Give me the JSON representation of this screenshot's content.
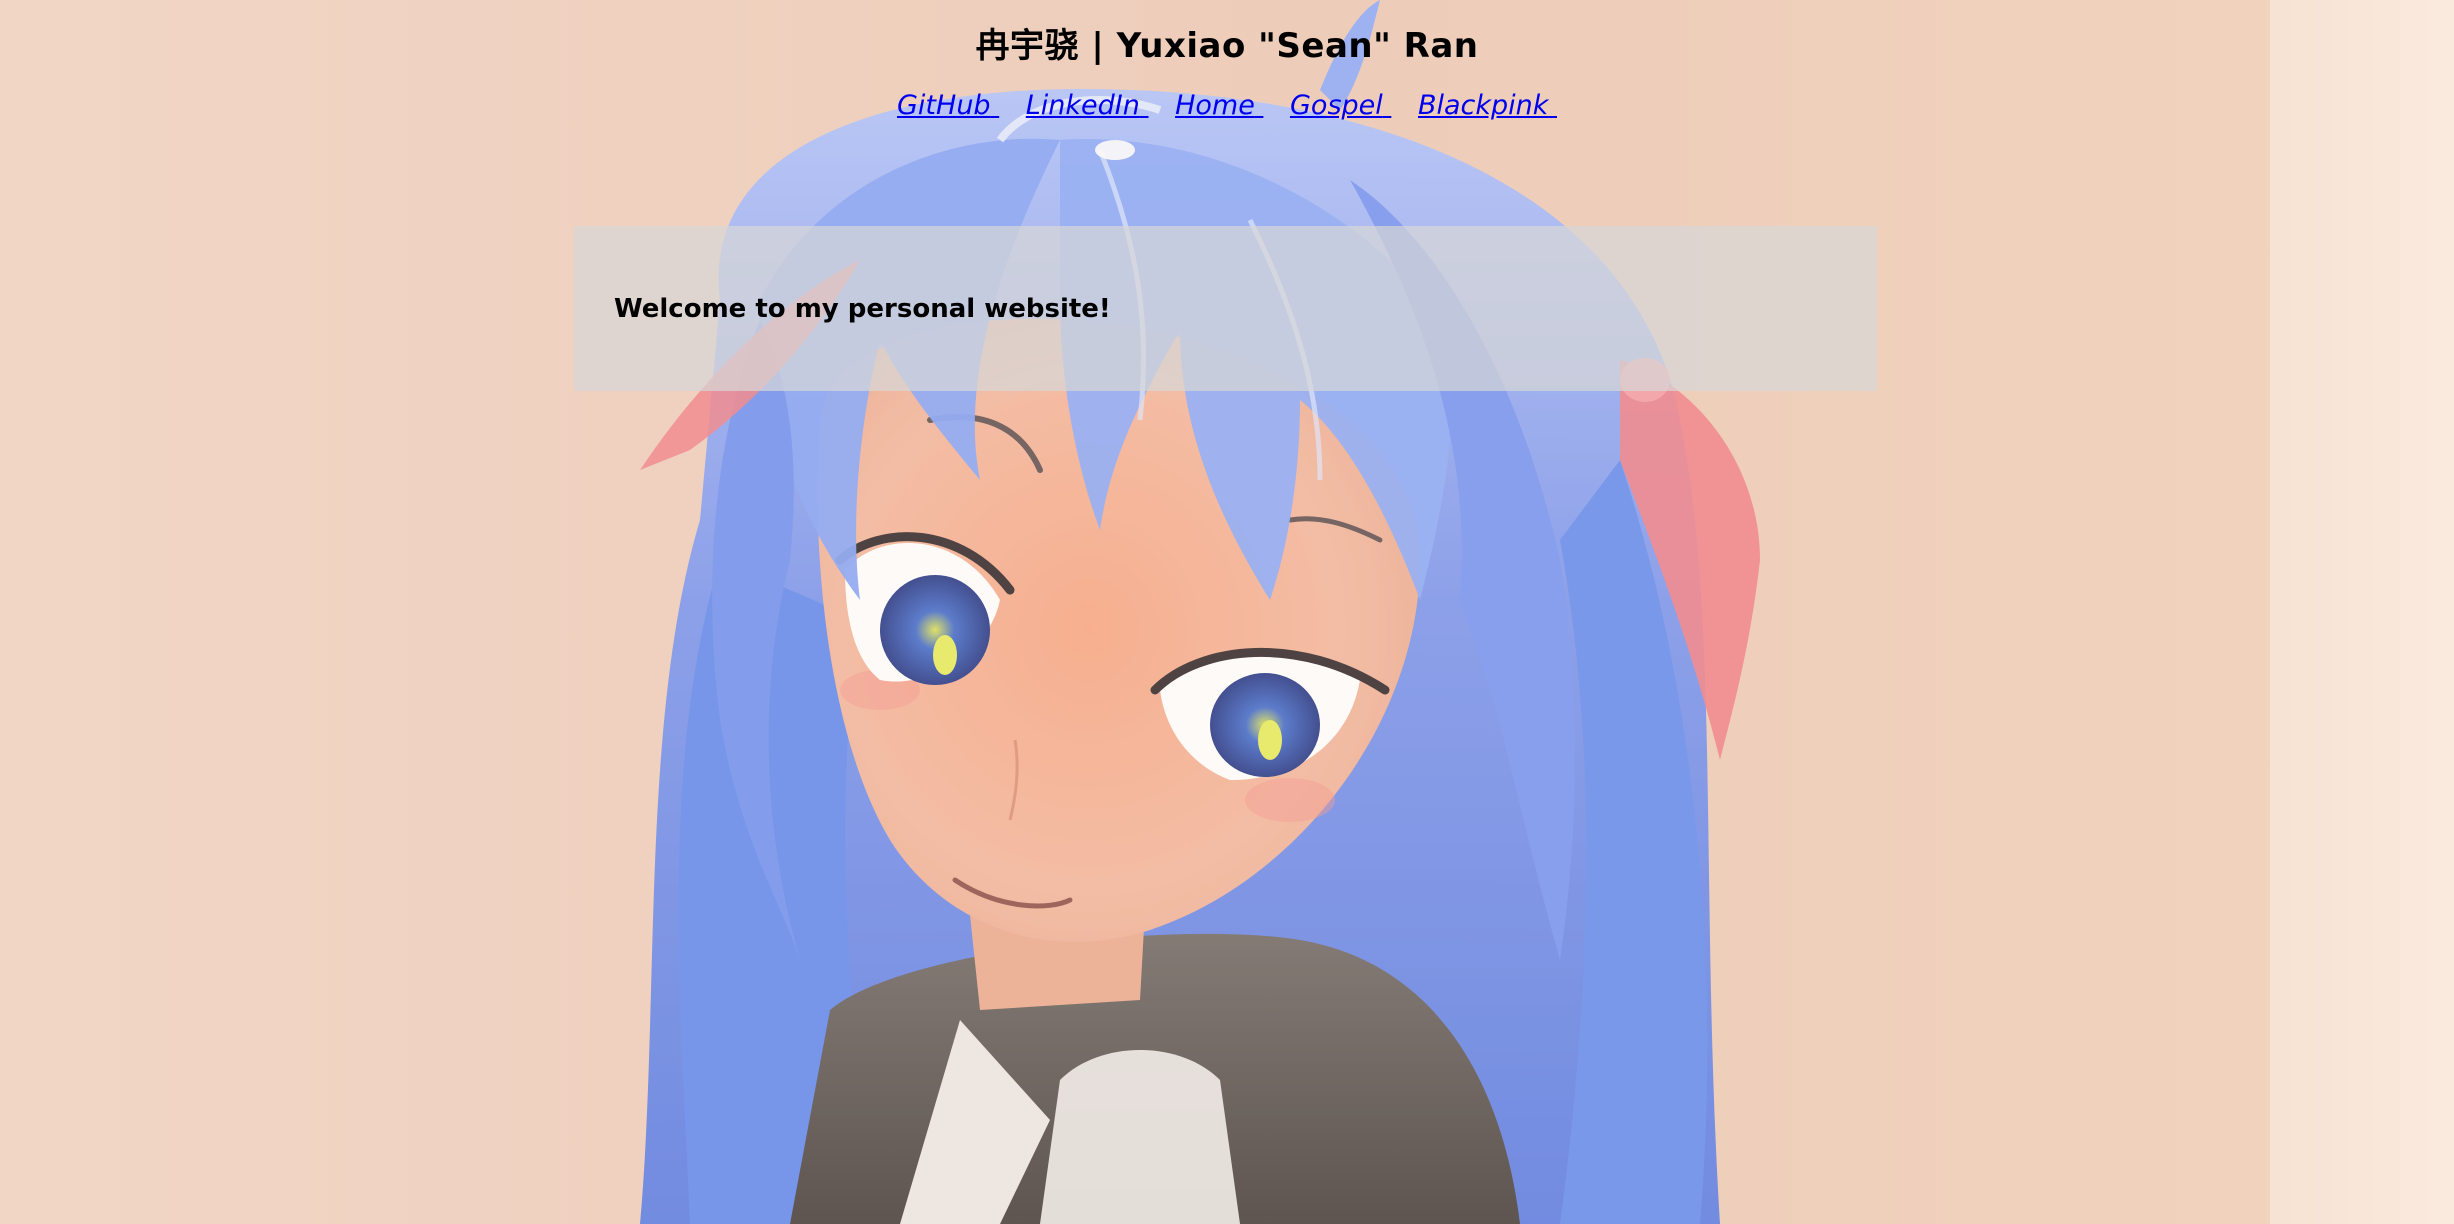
{
  "header": {
    "title": "冉宇骁 | Yuxiao \"Sean\" Ran"
  },
  "nav": {
    "links": [
      {
        "label": "GitHub"
      },
      {
        "label": "LinkedIn"
      },
      {
        "label": "Home"
      },
      {
        "label": "Gospel"
      },
      {
        "label": "Blackpink"
      }
    ]
  },
  "main": {
    "welcome": "Welcome to my personal website!"
  },
  "colors": {
    "link": "#0000ee",
    "text": "#000000",
    "background_warm": "#eecfbd",
    "hair_blue": "#6f8ff0",
    "ribbon_pink": "#f07a80"
  },
  "background_image": {
    "icon": "anime-character-illustration"
  }
}
